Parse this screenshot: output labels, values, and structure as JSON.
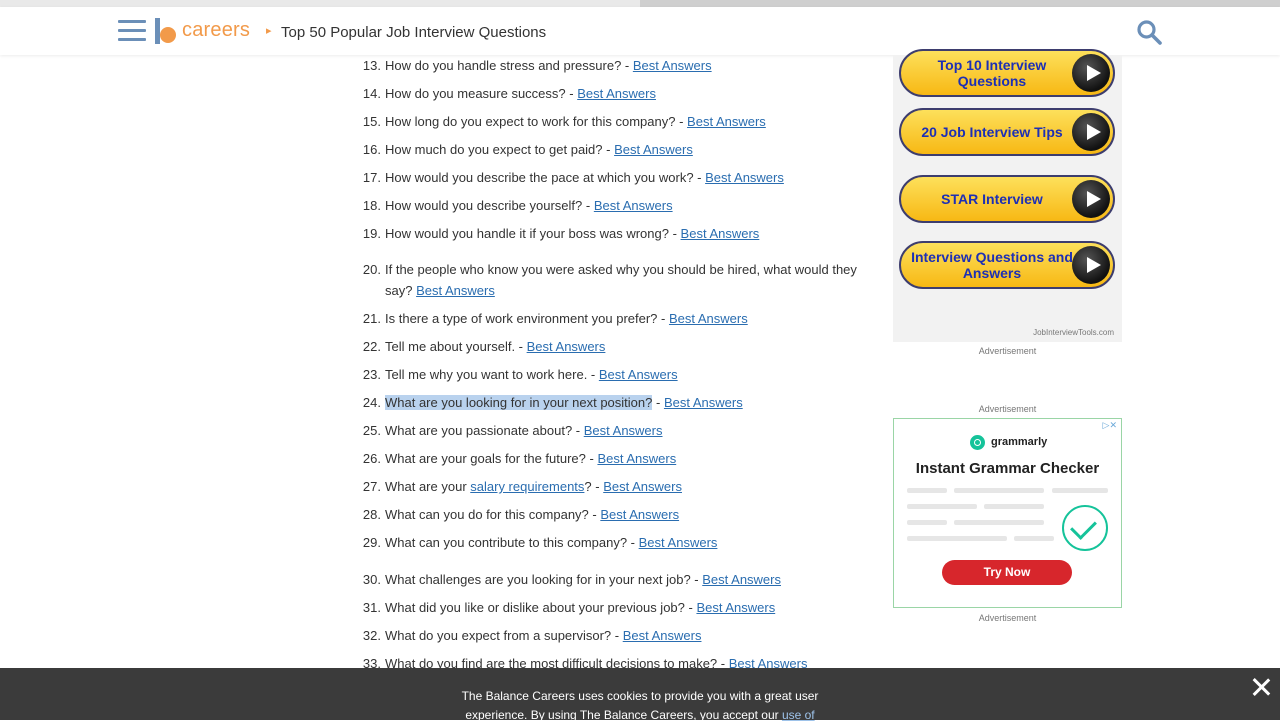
{
  "header": {
    "logo_text": "careers",
    "breadcrumb_arrow": "▸",
    "page_title": "Top 50 Popular Job Interview Questions"
  },
  "questions": [
    {
      "num": "13.",
      "text": "How do you handle stress and pressure? - ",
      "link": "Best Answers"
    },
    {
      "num": "14.",
      "text": "How do you measure success? - ",
      "link": "Best Answers"
    },
    {
      "num": "15.",
      "text": "How long do you expect to work for this company? - ",
      "link": "Best Answers"
    },
    {
      "num": "16.",
      "text": "How much do you expect to get paid? - ",
      "link": "Best Answers"
    },
    {
      "num": "17.",
      "text": "How would you describe the pace at which you work? - ",
      "link": "Best Answers"
    },
    {
      "num": "18.",
      "text": "How would you describe yourself? - ",
      "link": "Best Answers"
    },
    {
      "num": "19.",
      "text": "How would you handle it if your boss was wrong? - ",
      "link": "Best Answers"
    },
    {
      "num": "20.",
      "text": "If the people who know you were asked why you should be hired, what would they say? ",
      "link": "Best Answers"
    },
    {
      "num": "21.",
      "text": "Is there a type of work environment you prefer? - ",
      "link": "Best Answers"
    },
    {
      "num": "22.",
      "text": "Tell me about yourself. - ",
      "link": "Best Answers"
    },
    {
      "num": "23.",
      "text": "Tell me why you want to work here. - ",
      "link": "Best Answers"
    },
    {
      "num": "24.",
      "text_highlight": "What are you looking for in your next position?",
      "text": " - ",
      "link": "Best Answers"
    },
    {
      "num": "25.",
      "text": "What are you passionate about? - ",
      "link": "Best Answers"
    },
    {
      "num": "26.",
      "text": "What are your goals for the future? - ",
      "link": "Best Answers"
    },
    {
      "num": "27.",
      "text_pre": "What are your ",
      "inline_link": "salary requirements",
      "text": "? - ",
      "link": "Best Answers"
    },
    {
      "num": "28.",
      "text": "What can you do for this company? - ",
      "link": "Best Answers"
    },
    {
      "num": "29.",
      "text": "What can you contribute to this company? - ",
      "link": "Best Answers"
    },
    {
      "num": "30.",
      "text": "What challenges are you looking for in your next job? - ",
      "link": "Best Answers"
    },
    {
      "num": "31.",
      "text": "What did you like or dislike about your previous job? - ",
      "link": "Best Answers"
    },
    {
      "num": "32.",
      "text": "What do you expect from a supervisor? - ",
      "link": "Best Answers"
    },
    {
      "num": "33.",
      "text": "What do you find are the most difficult decisions to make? - ",
      "link": "Best Answers"
    }
  ],
  "sidebar": {
    "ad1_buttons": [
      "Top 10 Interview Questions",
      "20 Job Interview Tips",
      "STAR Interview",
      "Interview Questions and Answers"
    ],
    "ad1_credit": "JobInterviewTools.com",
    "advertisement_label": "Advertisement",
    "ad2": {
      "brand": "grammarly",
      "headline": "Instant Grammar Checker",
      "cta": "Try Now",
      "close": "▷✕"
    }
  },
  "cookie": {
    "text": "The Balance Careers uses cookies to provide you with a great user experience. By using The Balance Careers, you accept our ",
    "link": "use of"
  },
  "colors": {
    "accent": "#f29a4a",
    "link": "#2a6db0",
    "highlight": "#b9d2ee"
  }
}
